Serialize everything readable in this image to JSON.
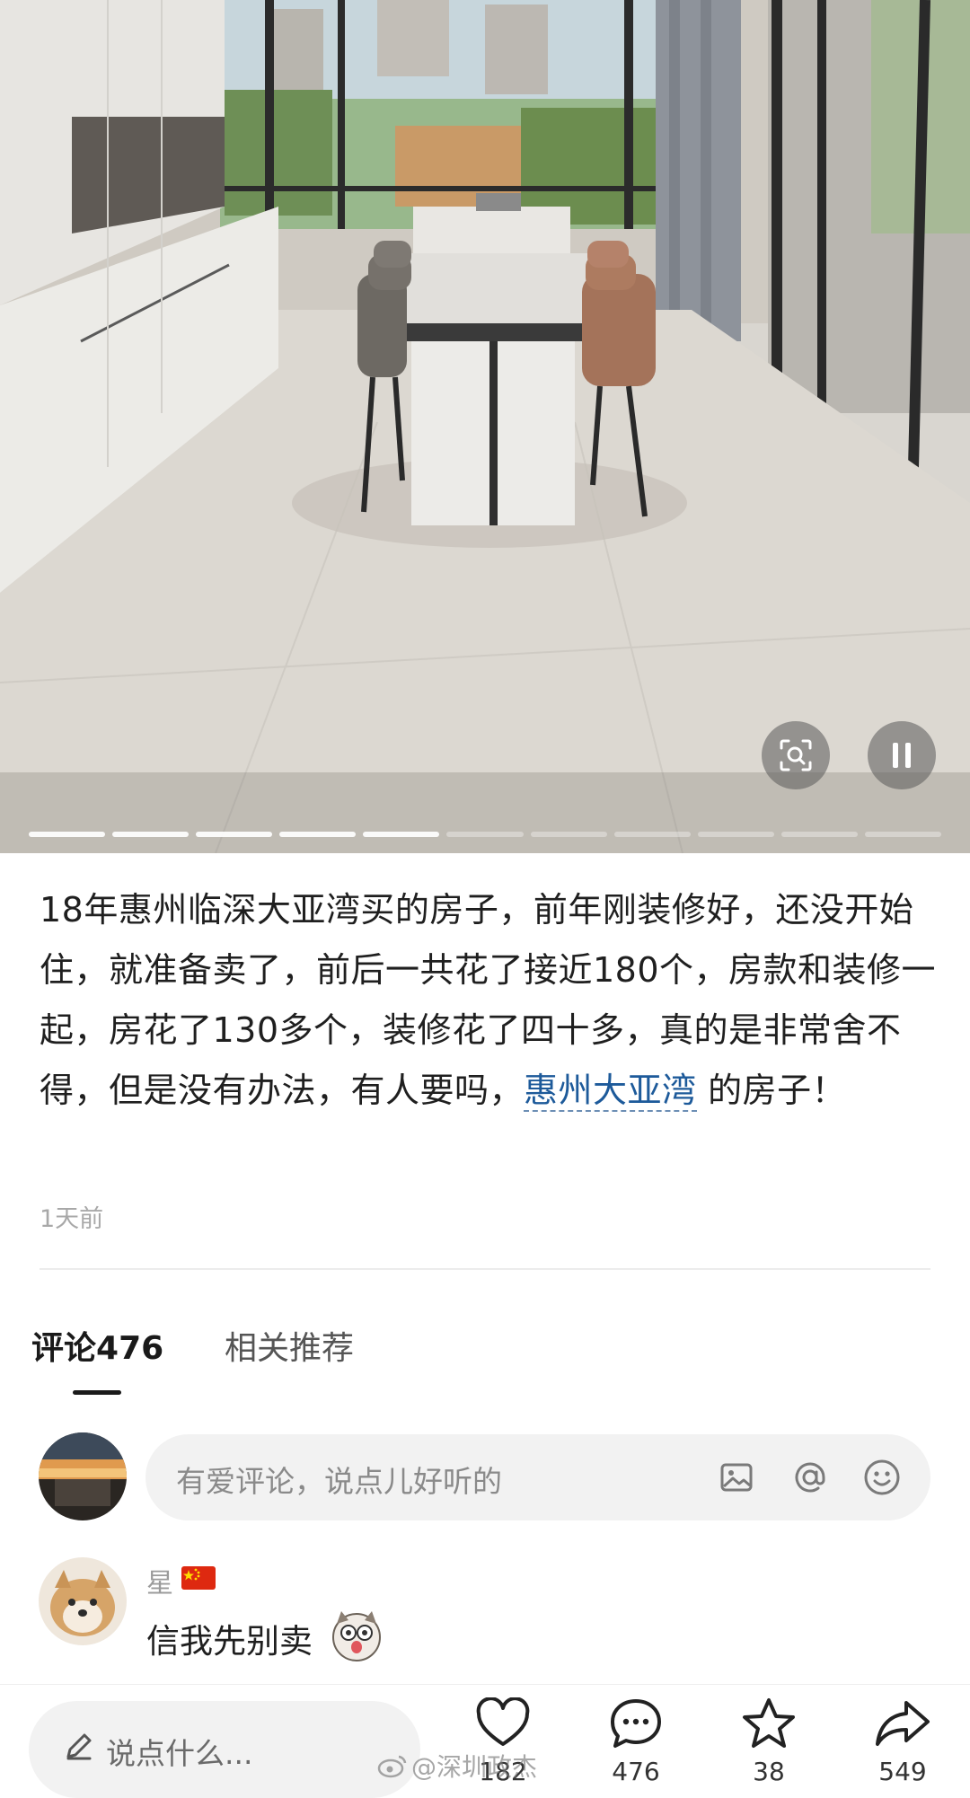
{
  "post": {
    "text_before_topic": "18年惠州临深大亚湾买的房子，前年刚装修好，还没开始住，就准备卖了，前后一共花了接近180个，房款和装修一起，房花了130多个，装修花了四十多，真的是非常舍不得，但是没有办法，有人要吗，",
    "topic": "惠州大亚湾",
    "text_after_topic": " 的房子！",
    "time": "1天前"
  },
  "media": {
    "progress_total": 11,
    "progress_completed": 5,
    "scan_icon": "scan-search-icon",
    "pause_icon": "pause-icon"
  },
  "tabs": {
    "comments_label": "评论",
    "comments_count": "476",
    "related_label": "相关推荐"
  },
  "comment_input": {
    "placeholder": "有爱评论，说点儿好听的",
    "icons": [
      "image-icon",
      "at-icon",
      "emoji-icon"
    ]
  },
  "comments": [
    {
      "user": "星",
      "text": "信我先别卖"
    }
  ],
  "bottom_bar": {
    "input_placeholder": "说点什么...",
    "likes": "182",
    "comments": "476",
    "favorites": "38",
    "shares": "549"
  },
  "watermark": "@深圳政杰",
  "colors": {
    "topic_link": "#1d5a9a",
    "flag_red": "#de2910"
  }
}
